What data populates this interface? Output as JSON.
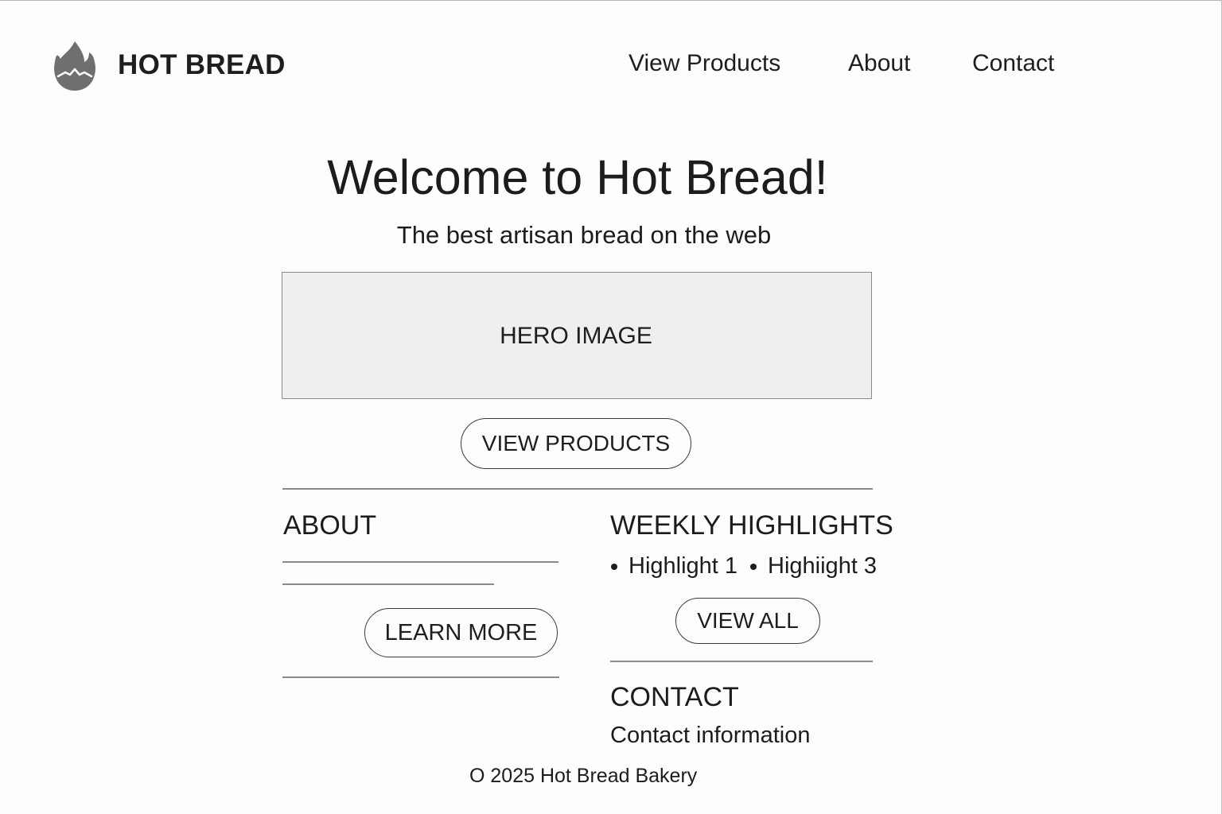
{
  "header": {
    "logo_icon": "flame-icon",
    "brand": "HOT BREAD",
    "nav": [
      {
        "label": "View Products"
      },
      {
        "label": "About"
      },
      {
        "label": "Contact"
      }
    ]
  },
  "hero": {
    "title": "Welcome to Hot Bread!",
    "subtitle": "The best artisan bread on the web",
    "image_placeholder": "HERO IMAGE",
    "cta_label": "VIEW PRODUCTS"
  },
  "about": {
    "heading": "ABOUT",
    "button_label": "LEARN MORE"
  },
  "highlights": {
    "heading": "WEEKLY HIGHLIGHTS",
    "items": [
      "Highlight 1",
      "Highiight 3"
    ],
    "button_label": "VIEW ALL"
  },
  "contact": {
    "heading": "CONTACT",
    "info": "Contact information"
  },
  "footer": {
    "copyright": "O 2025 Hot Bread Bakery"
  },
  "colors": {
    "text": "#1c1c1c",
    "logo": "#6f6f6f",
    "placeholder_bg": "#efefef",
    "border": "#8a8a8a"
  }
}
